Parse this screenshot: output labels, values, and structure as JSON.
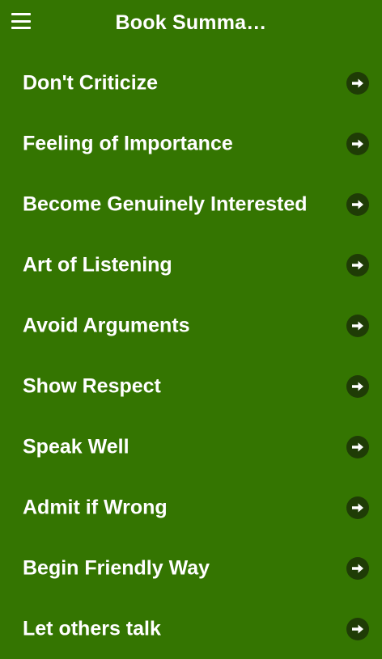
{
  "appbar": {
    "title": "Book Summa…",
    "menu_icon": "hamburger-menu-icon"
  },
  "colors": {
    "background": "#347501",
    "arrow_circle": "#1f3c06",
    "text": "#ffffff"
  },
  "list": {
    "item_icon": "arrow-right-circle-icon",
    "items": [
      {
        "label": "Don't Criticize"
      },
      {
        "label": "Feeling of Importance"
      },
      {
        "label": "Become Genuinely Interested"
      },
      {
        "label": "Art of Listening"
      },
      {
        "label": "Avoid Arguments"
      },
      {
        "label": "Show Respect"
      },
      {
        "label": "Speak Well"
      },
      {
        "label": "Admit if Wrong"
      },
      {
        "label": "Begin Friendly Way"
      },
      {
        "label": "Let others talk"
      }
    ]
  }
}
